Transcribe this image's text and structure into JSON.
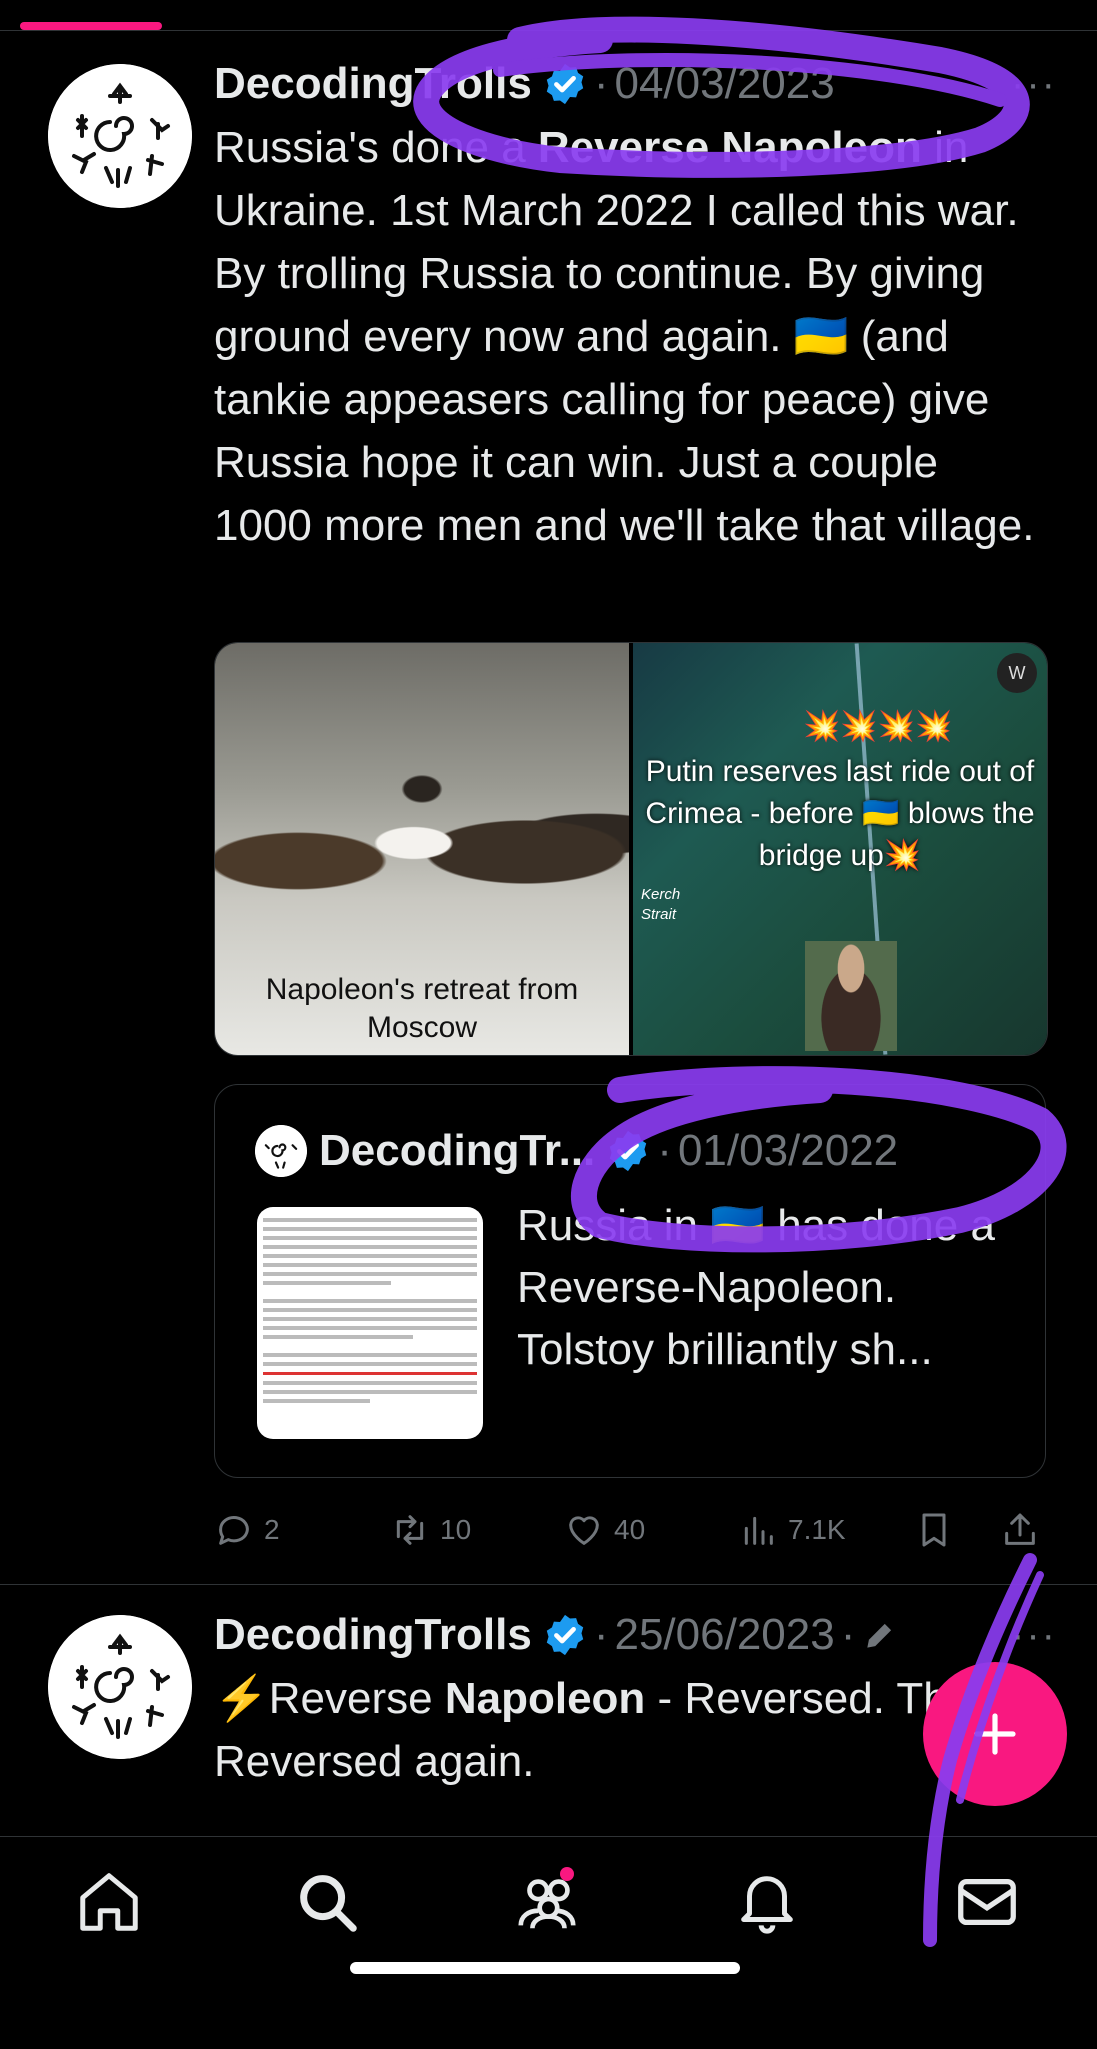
{
  "tweets": [
    {
      "author": "DecodingTrolls",
      "date": "04/03/2023",
      "separator": "·",
      "body_parts": [
        {
          "text": "Russia's done a ",
          "bold": false
        },
        {
          "text": "Reverse Napoleon",
          "bold": true
        },
        {
          "text": " in Ukraine. 1st March 2022 I called this war. By trolling Russia to continue. By giving ground every now and again. 🇺🇦 (and tankie appeasers calling for peace) give Russia hope it can win. Just a couple 1000 more men and we'll take that village.",
          "bold": false
        }
      ],
      "media": {
        "left_caption": "Napoleon's retreat from Moscow",
        "right_caption": "Putin reserves last ride out of Crimea - before 🇺🇦 blows the bridge up💥",
        "right_booms": "💥💥💥💥",
        "right_map_label": "Kerch Strait",
        "right_watermark": "W"
      },
      "quote": {
        "author": "DecodingTr...",
        "date": "01/03/2022",
        "text": "Russia in 🇺🇦 has done a Reverse-Napoleon. Tolstoy brilliantly sh..."
      },
      "stats": {
        "replies": "2",
        "retweets": "10",
        "likes": "40",
        "views": "7.1K"
      }
    },
    {
      "author": "DecodingTrolls",
      "date": "25/06/2023",
      "separator": "·",
      "body_parts": [
        {
          "text": "⚡️Reverse ",
          "bold": false
        },
        {
          "text": "Napoleon",
          "bold": true
        },
        {
          "text": " - Reversed. Then, Reversed again.",
          "bold": false
        }
      ]
    }
  ],
  "more_label": "···",
  "icons": {
    "verified": "verified-badge-icon",
    "reply": "reply-icon",
    "retweet": "retweet-icon",
    "like": "heart-icon",
    "views": "views-icon",
    "bookmark": "bookmark-icon",
    "share": "share-icon",
    "compose": "plus-icon",
    "nav": [
      "home-icon",
      "search-icon",
      "communities-icon",
      "notifications-icon",
      "messages-icon"
    ]
  },
  "colors": {
    "background": "#000000",
    "text": "#e7e9ea",
    "muted": "#71767b",
    "accent": "#f91880",
    "verified": "#1d9bf0",
    "annotation": "#8a3cf0"
  }
}
